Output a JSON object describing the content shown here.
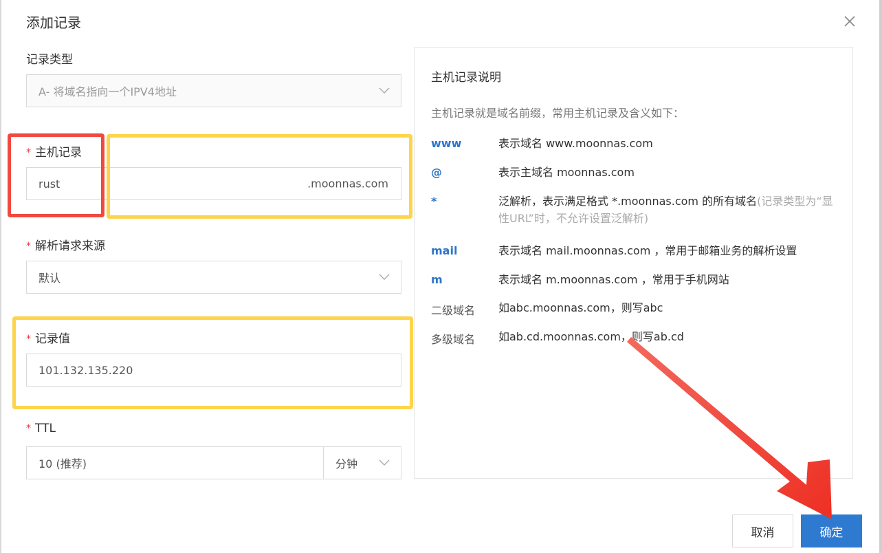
{
  "dialog": {
    "title": "添加记录"
  },
  "form": {
    "record_type": {
      "label": "记录类型",
      "value": "A- 将域名指向一个IPV4地址"
    },
    "host": {
      "label": "主机记录",
      "value": "rust",
      "suffix": ".moonnas.com"
    },
    "resolve_source": {
      "label": "解析请求来源",
      "value": "默认"
    },
    "record_value": {
      "label": "记录值",
      "value": "101.132.135.220"
    },
    "ttl": {
      "label": "TTL",
      "value": "10 (推荐)",
      "unit": "分钟"
    },
    "required_mark": "*"
  },
  "help": {
    "title": "主机记录说明",
    "desc": "主机记录就是域名前缀，常用主机记录及含义如下：",
    "rows": [
      {
        "key": "www",
        "text": "表示域名 www.moonnas.com",
        "note": ""
      },
      {
        "key": "@",
        "text": "表示主域名 moonnas.com",
        "note": ""
      },
      {
        "key": "*",
        "text": "泛解析，表示满足格式 *.moonnas.com 的所有域名",
        "note": "(记录类型为“显性URL”时，不允许设置泛解析)"
      },
      {
        "key": "mail",
        "text": "表示域名 mail.moonnas.com ，常用于邮箱业务的解析设置",
        "note": ""
      },
      {
        "key": "m",
        "text": "表示域名 m.moonnas.com ，常用于手机网站",
        "note": ""
      },
      {
        "key": "二级域名",
        "text": "如abc.moonnas.com，则写abc",
        "note": ""
      },
      {
        "key": "多级域名",
        "text": "如ab.cd.moonnas.com，则写ab.cd",
        "note": ""
      }
    ]
  },
  "buttons": {
    "cancel": "取消",
    "confirm": "确定"
  },
  "colors": {
    "primary": "#2e7ad1",
    "link": "#2e75c8",
    "required": "#e4393c",
    "annotation_red": "#f04a3f",
    "annotation_yellow": "#fdd44a"
  }
}
